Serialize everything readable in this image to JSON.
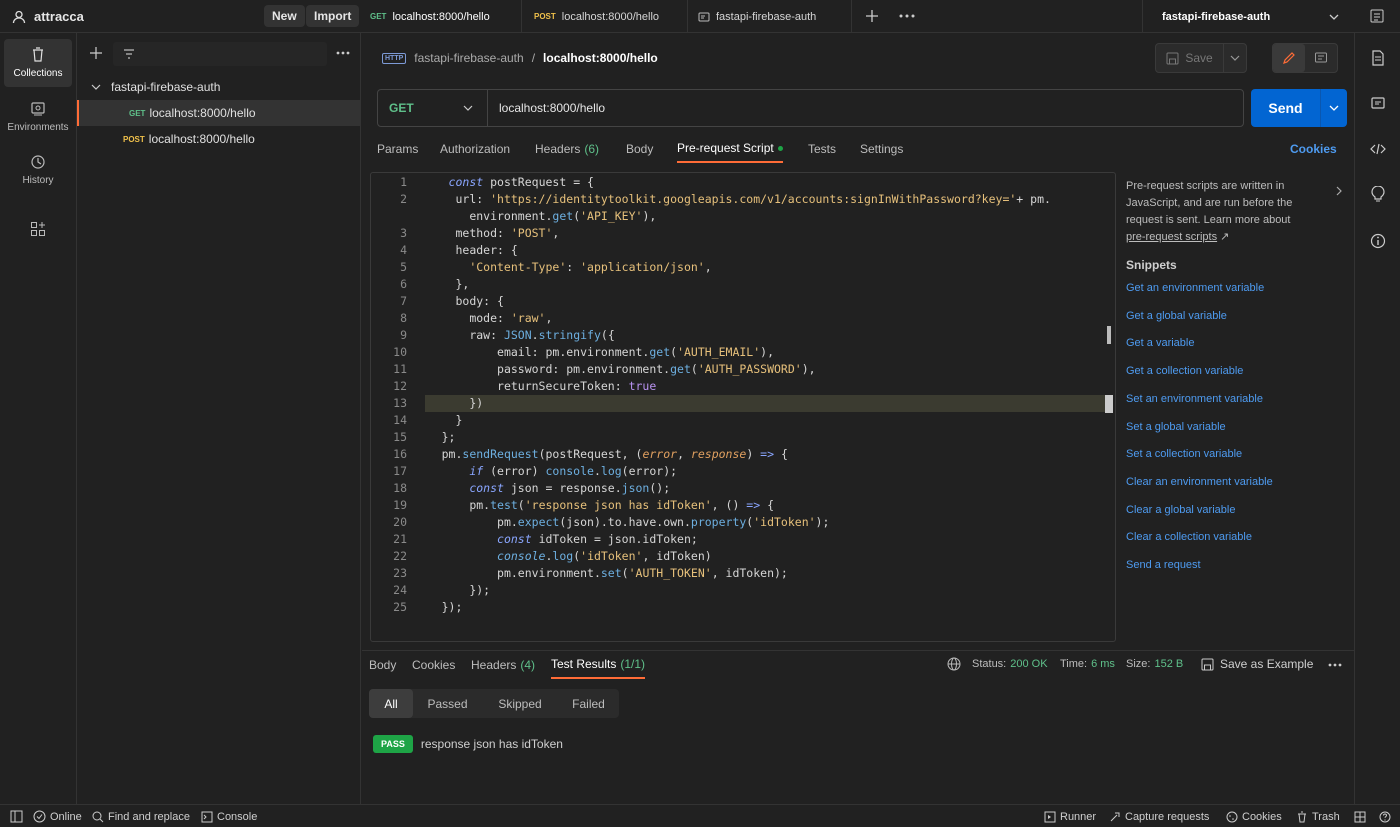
{
  "app": {
    "workspace": "attracca",
    "new_label": "New",
    "import_label": "Import"
  },
  "tabs": [
    {
      "method": "GET",
      "label": "localhost:8000/hello"
    },
    {
      "method": "POST",
      "label": "localhost:8000/hello"
    },
    {
      "method": "",
      "label": "fastapi-firebase-auth"
    }
  ],
  "environment": {
    "selected": "fastapi-firebase-auth"
  },
  "rail": [
    {
      "label": "Collections"
    },
    {
      "label": "Environments"
    },
    {
      "label": "History"
    }
  ],
  "sidebar": {
    "collection": "fastapi-firebase-auth",
    "items": [
      {
        "method": "GET",
        "label": "localhost:8000/hello"
      },
      {
        "method": "POST",
        "label": "localhost:8000/hello"
      }
    ]
  },
  "request": {
    "breadcrumb_collection": "fastapi-firebase-auth",
    "breadcrumb_sep": "/",
    "breadcrumb_request": "localhost:8000/hello",
    "save_label": "Save",
    "method": "GET",
    "url": "localhost:8000/hello",
    "send_label": "Send",
    "http_badge": "HTTP"
  },
  "req_tabs": {
    "params": "Params",
    "authorization": "Authorization",
    "headers": "Headers",
    "headers_count": "(6)",
    "body": "Body",
    "prerequest": "Pre-request Script",
    "tests": "Tests",
    "settings": "Settings",
    "cookies": "Cookies"
  },
  "code": {
    "line_numbers": [
      "1",
      "2",
      "",
      "3",
      "4",
      "5",
      "6",
      "7",
      "8",
      "9",
      "10",
      "11",
      "12",
      "13",
      "14",
      "15",
      "16",
      "17",
      "18",
      "19",
      "20",
      "21",
      "22",
      "23",
      "24",
      "25"
    ]
  },
  "help": {
    "text1": "Pre-request scripts are written in",
    "text2": "JavaScript, and are run before the",
    "text3": "request is sent. Learn more about",
    "link": "pre-request scripts",
    "link_arrow": "↗",
    "snippets_title": "Snippets",
    "snippets": [
      "Get an environment variable",
      "Get a global variable",
      "Get a variable",
      "Get a collection variable",
      "Set an environment variable",
      "Set a global variable",
      "Set a collection variable",
      "Clear an environment variable",
      "Clear a global variable",
      "Clear a collection variable",
      "Send a request"
    ]
  },
  "response": {
    "tabs": {
      "body": "Body",
      "cookies": "Cookies",
      "headers": "Headers",
      "headers_count": "(4)",
      "test_results": "Test Results",
      "test_count": "(1/1)"
    },
    "status_label": "Status:",
    "status_value": "200 OK",
    "time_label": "Time:",
    "time_value": "6 ms",
    "size_label": "Size:",
    "size_value": "152 B",
    "save_example": "Save as Example",
    "filters": [
      "All",
      "Passed",
      "Skipped",
      "Failed"
    ],
    "result_badge": "PASS",
    "result_text": "response json has idToken"
  },
  "statusbar": {
    "online": "Online",
    "find": "Find and replace",
    "console": "Console",
    "runner": "Runner",
    "capture": "Capture requests",
    "cookies": "Cookies",
    "trash": "Trash"
  },
  "colors": {
    "accent": "#0265d2",
    "orange": "#ff6c37",
    "pass": "#1ea446",
    "link": "#4e9bf0"
  }
}
